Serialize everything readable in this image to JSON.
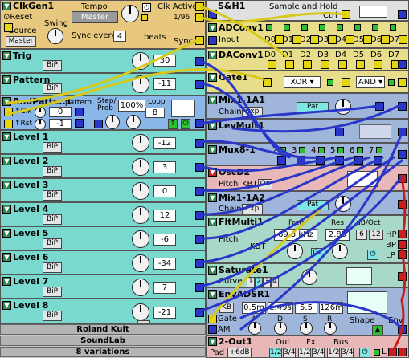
{
  "left": {
    "clkgen": {
      "title": "ClkGen1",
      "reset": "Reset",
      "swing": "Swing",
      "tempo_label": "Tempo",
      "tempo_value": "Master",
      "clk_active": "Clk Active",
      "div": "1/96",
      "source_label": "Source",
      "source_value": "Master",
      "sync_label": "Sync every",
      "sync_value": "4",
      "beats": "beats",
      "sync": "Sync"
    },
    "trig": {
      "title": "Trig",
      "bip": "BiP",
      "value": "30"
    },
    "pattern": {
      "title": "Pattern",
      "bip": "BiP",
      "value": "-11"
    },
    "rndpattern": {
      "title": "RndPatte..1",
      "pattern_label": "pattern",
      "step_prob": "Step/ Prob",
      "loop": "Loop",
      "clk": "Clk",
      "rst": "Rst",
      "a_val": "0",
      "b_val": "-1",
      "percent": "100%",
      "loop_val": "8"
    },
    "levels": [
      {
        "title": "Level 1",
        "bip": "BiP",
        "value": "-12"
      },
      {
        "title": "Level 2",
        "bip": "BiP",
        "value": "3"
      },
      {
        "title": "Level 3",
        "bip": "BiP",
        "value": "0"
      },
      {
        "title": "Level 4",
        "bip": "BiP",
        "value": "12"
      },
      {
        "title": "Level 5",
        "bip": "BiP",
        "value": "-6"
      },
      {
        "title": "Level 6",
        "bip": "BiP",
        "value": "-34"
      },
      {
        "title": "Level 7",
        "bip": "BiP",
        "value": "7"
      },
      {
        "title": "Level 8",
        "bip": "BiP",
        "value": "-21"
      }
    ],
    "footer": [
      "Roland Kuit",
      "SoundLab",
      "8 variations"
    ]
  },
  "right": {
    "sh": {
      "title": "S&H1",
      "subtitle": "Sample and Hold",
      "ctrl": "Ctrl"
    },
    "adconv": {
      "title": "ADConv1",
      "input": "Input",
      "bits": [
        "D0",
        "D1",
        "D2",
        "D3",
        "D4",
        "D5",
        "D6",
        "D7"
      ]
    },
    "daconv": {
      "title": "DAConv1",
      "bits": [
        "D0",
        "D1",
        "D2",
        "D3",
        "D4",
        "D5",
        "D6",
        "D7"
      ]
    },
    "gate": {
      "title": "Gate1",
      "op1": "XOR",
      "op2": "AND"
    },
    "mix1": {
      "title": "Mix1-1A1",
      "chain": "Chain",
      "exp": "Exp",
      "pat": "Pat"
    },
    "levmult": {
      "title": "LevMult1"
    },
    "mux": {
      "title": "Mux8-1",
      "slots": [
        "2",
        "3",
        "4",
        "5",
        "6",
        "7"
      ]
    },
    "osc": {
      "title": "OscD2",
      "pitch": "Pitch",
      "kbt": "KBT",
      "on": "On"
    },
    "mix2": {
      "title": "Mix1-1A2",
      "chain": "Chain",
      "exp": "Exp",
      "pat": "Pat"
    },
    "filter": {
      "title": "FltMulti1",
      "freq_label": "Freq",
      "res_label": "Res",
      "db_label": "dB/Oct",
      "freq_value": "69.3 kHz",
      "res_value": "2.85",
      "db_a": "6",
      "db_b": "12",
      "pitch": "Pitch",
      "kbt": "KBT",
      "gc": "GC",
      "hp": "HP",
      "bp": "BP",
      "lp": "LP"
    },
    "saturate": {
      "title": "Saturate1",
      "curve": "Curve",
      "c1": "1",
      "c2": "2",
      "c3": "3",
      "c4": "4"
    },
    "env": {
      "title": "EnvADSR1",
      "kb": "KB",
      "a": "0.5m",
      "d": "1.49s",
      "s": "5.5",
      "r": "126m",
      "gate": "Gate",
      "am": "AM",
      "labels": [
        "A",
        "D",
        "S",
        "R"
      ],
      "shape": "Shape",
      "env": "Env"
    },
    "out": {
      "title": "2-Out1",
      "pad": "Pad",
      "pad_val": "+6dB",
      "out_label": "Out",
      "fx_label": "Fx",
      "bus_label": "Bus",
      "out_opts": [
        "1/2",
        "3/4"
      ],
      "fx_opts": [
        "1/2",
        "3/4"
      ],
      "bus_opts": [
        "1/2",
        "3/4"
      ],
      "l": "L"
    }
  }
}
